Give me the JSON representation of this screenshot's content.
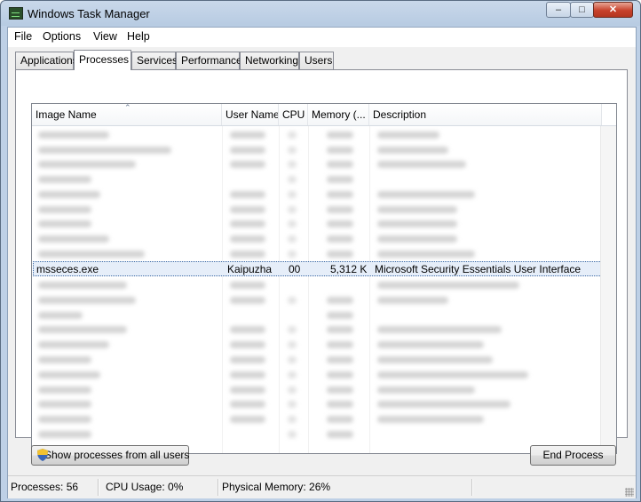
{
  "window": {
    "title": "Windows Task Manager",
    "controls": {
      "minimize": "–",
      "maximize": "□",
      "close": "✕"
    }
  },
  "menu": [
    {
      "label": "File"
    },
    {
      "label": "Options"
    },
    {
      "label": "View"
    },
    {
      "label": "Help"
    }
  ],
  "tabs": [
    {
      "label": "Applications"
    },
    {
      "label": "Processes"
    },
    {
      "label": "Services"
    },
    {
      "label": "Performance"
    },
    {
      "label": "Networking"
    },
    {
      "label": "Users"
    }
  ],
  "active_tab": "Processes",
  "table": {
    "columns": [
      "Image Name",
      "User Name",
      "CPU",
      "Memory (...",
      "Description"
    ],
    "sort_column": "Image Name",
    "selected_row": {
      "image_name": "msseces.exe",
      "user_name": "Kaipuzha",
      "cpu": "00",
      "memory": "5,312 K",
      "description": "Microsoft Security Essentials User Interface"
    }
  },
  "buttons": {
    "show_all": "Show processes from all users",
    "end_process": "End Process"
  },
  "status": {
    "processes": "Processes: 56",
    "cpu": "CPU Usage: 0%",
    "memory": "Physical Memory: 26%"
  },
  "colors": {
    "selection": "#e6eef9",
    "selection_border": "#3c6aa5",
    "title_bar": "#c9d8ea"
  }
}
